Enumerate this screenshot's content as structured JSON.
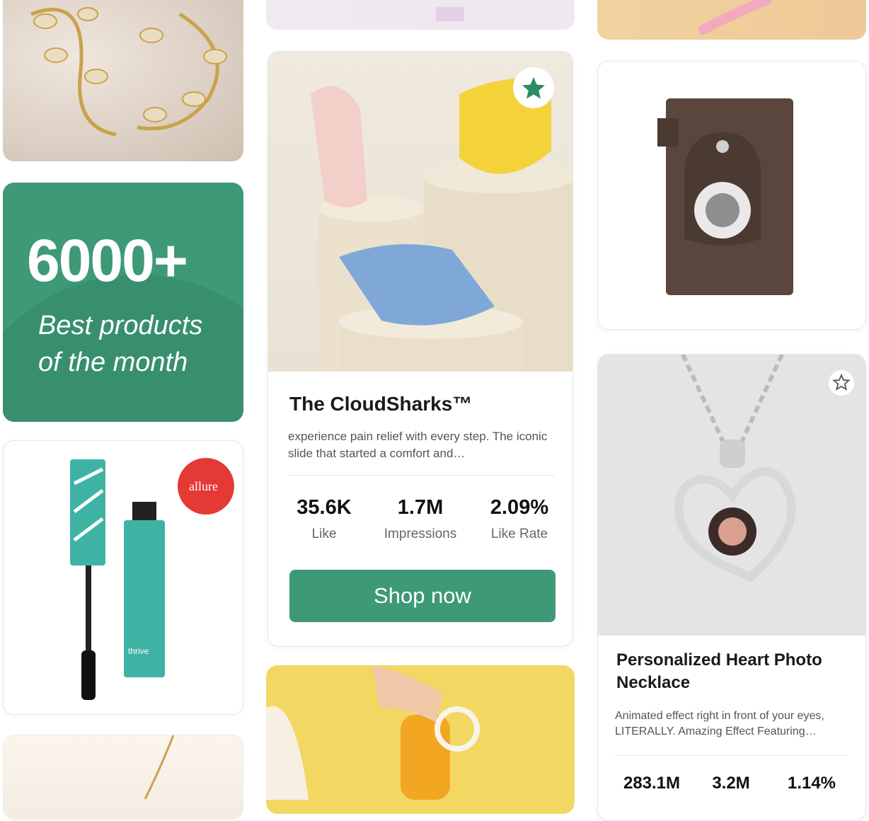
{
  "promo": {
    "headline": "6000+",
    "subline1": "Best products",
    "subline2": "of the month"
  },
  "featured": {
    "title": "The CloudSharks™",
    "description": "experience pain relief with every step. The iconic slide that started a comfort and…",
    "stats": [
      {
        "value": "35.6K",
        "label": "Like"
      },
      {
        "value": "1.7M",
        "label": "Impressions"
      },
      {
        "value": "2.09%",
        "label": "Like Rate"
      }
    ],
    "cta": "Shop now"
  },
  "necklace": {
    "title": "Personalized Heart Photo Necklace",
    "description": "Animated effect right in front of your eyes, LITERALLY.   Amazing Effect Featuring…",
    "stats": [
      {
        "value": "283.1M"
      },
      {
        "value": "3.2M"
      },
      {
        "value": "1.14%"
      }
    ]
  },
  "mascara": {
    "badge_text": "allure",
    "brand": "thrive"
  },
  "icons": {
    "favorite_active": "star-filled-icon",
    "favorite_inactive": "star-outline-icon"
  },
  "colors": {
    "accent": "#3e9977"
  }
}
